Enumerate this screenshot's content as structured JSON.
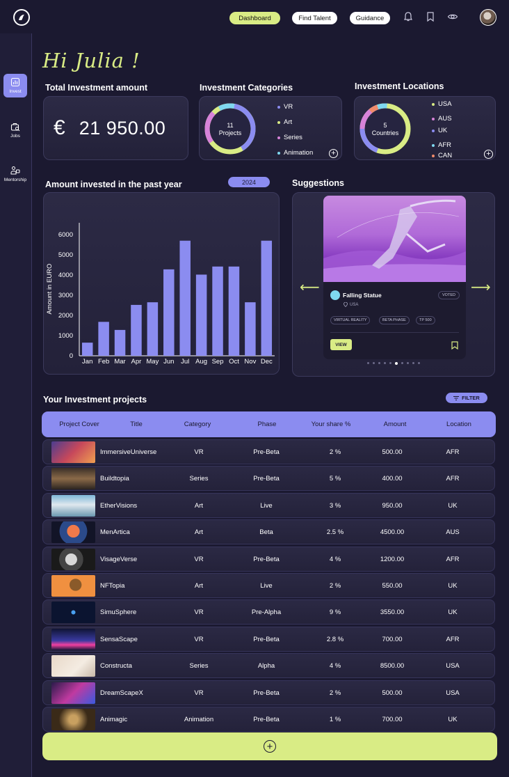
{
  "nav": {
    "tabs": [
      "Dashboard",
      "Find Talent",
      "Guidance"
    ],
    "active_tab": "Dashboard"
  },
  "sidebar": {
    "items": [
      {
        "label": "Invest",
        "icon": "chart-icon",
        "active": true
      },
      {
        "label": "Jobs",
        "icon": "briefcase-search-icon",
        "active": false
      },
      {
        "label": "Mentorship",
        "icon": "mentorship-icon",
        "active": false
      }
    ]
  },
  "greeting": "Hi Julia !",
  "total_investment": {
    "title": "Total Investment amount",
    "currency": "€",
    "amount": "21 950.00"
  },
  "categories": {
    "title": "Investment Categories",
    "center_count": "11",
    "center_label": "Projects",
    "items": [
      {
        "label": "VR",
        "color": "#8b8cf0"
      },
      {
        "label": "Art",
        "color": "#d9ec85"
      },
      {
        "label": "Series",
        "color": "#d783d9"
      },
      {
        "label": "Animation",
        "color": "#7fd8f0"
      }
    ]
  },
  "locations": {
    "title": "Investment Locations",
    "center_count": "5",
    "center_label": "Countries",
    "items": [
      {
        "label": "USA",
        "color": "#d9ec85"
      },
      {
        "label": "AUS",
        "color": "#d783d9"
      },
      {
        "label": "UK",
        "color": "#8b8cf0"
      },
      {
        "label": "AFR",
        "color": "#7fd8f0"
      },
      {
        "label": "CAN",
        "color": "#f08b6b"
      }
    ]
  },
  "amount_chart": {
    "title": "Amount invested in the past year",
    "year": "2024"
  },
  "chart_data": {
    "type": "bar",
    "categories": [
      "Jan",
      "Feb",
      "Mar",
      "Apr",
      "May",
      "Jun",
      "Jul",
      "Aug",
      "Sep",
      "Oct",
      "Nov",
      "Dec"
    ],
    "values": [
      650,
      1680,
      1280,
      2520,
      2650,
      4280,
      5700,
      4020,
      4420,
      4420,
      2650,
      5700
    ],
    "title": "",
    "xlabel": "",
    "ylabel": "Amount in EURO",
    "ylim": [
      0,
      6000
    ],
    "yticks": [
      0,
      1000,
      2000,
      3000,
      4000,
      5000,
      6000
    ],
    "bar_color": "#8b8cf0",
    "grid": false
  },
  "suggestions": {
    "title": "Suggestions",
    "name": "Falling Statue",
    "badge": "VOTED",
    "location": "USA",
    "tags": [
      "VIRTUAL REALITY",
      "BETA PHASE",
      "TP 500"
    ],
    "view_label": "VIEW"
  },
  "projects": {
    "title": "Your Investment projects",
    "filter_label": "FILTER",
    "columns": [
      "Project Cover",
      "Title",
      "Category",
      "Phase",
      "Your share %",
      "Amount",
      "Location"
    ],
    "rows": [
      {
        "title": "ImmersiveUniverse",
        "category": "VR",
        "phase": "Pre-Beta",
        "share": "2 %",
        "amount": "500.00",
        "location": "AFR"
      },
      {
        "title": "Buildtopia",
        "category": "Series",
        "phase": "Pre-Beta",
        "share": "5 %",
        "amount": "400.00",
        "location": "AFR"
      },
      {
        "title": "EtherVisions",
        "category": "Art",
        "phase": "Live",
        "share": "3 %",
        "amount": "950.00",
        "location": "UK"
      },
      {
        "title": "MenArtica",
        "category": "Art",
        "phase": "Beta",
        "share": "2.5 %",
        "amount": "4500.00",
        "location": "AUS"
      },
      {
        "title": "VisageVerse",
        "category": "VR",
        "phase": "Pre-Beta",
        "share": "4 %",
        "amount": "1200.00",
        "location": "AFR"
      },
      {
        "title": "NFTopia",
        "category": "Art",
        "phase": "Live",
        "share": "2 %",
        "amount": "550.00",
        "location": "UK"
      },
      {
        "title": "SimuSphere",
        "category": "VR",
        "phase": "Pre-Alpha",
        "share": "9 %",
        "amount": "3550.00",
        "location": "UK"
      },
      {
        "title": "SensaScape",
        "category": "VR",
        "phase": "Pre-Beta",
        "share": "2.8 %",
        "amount": "700.00",
        "location": "AFR"
      },
      {
        "title": "Constructa",
        "category": "Series",
        "phase": "Alpha",
        "share": "4 %",
        "amount": "8500.00",
        "location": "USA"
      },
      {
        "title": "DreamScapeX",
        "category": "VR",
        "phase": "Pre-Beta",
        "share": "2 %",
        "amount": "500.00",
        "location": "USA"
      },
      {
        "title": "Animagic",
        "category": "Animation",
        "phase": "Pre-Beta",
        "share": "1 %",
        "amount": "700.00",
        "location": "UK"
      }
    ]
  }
}
